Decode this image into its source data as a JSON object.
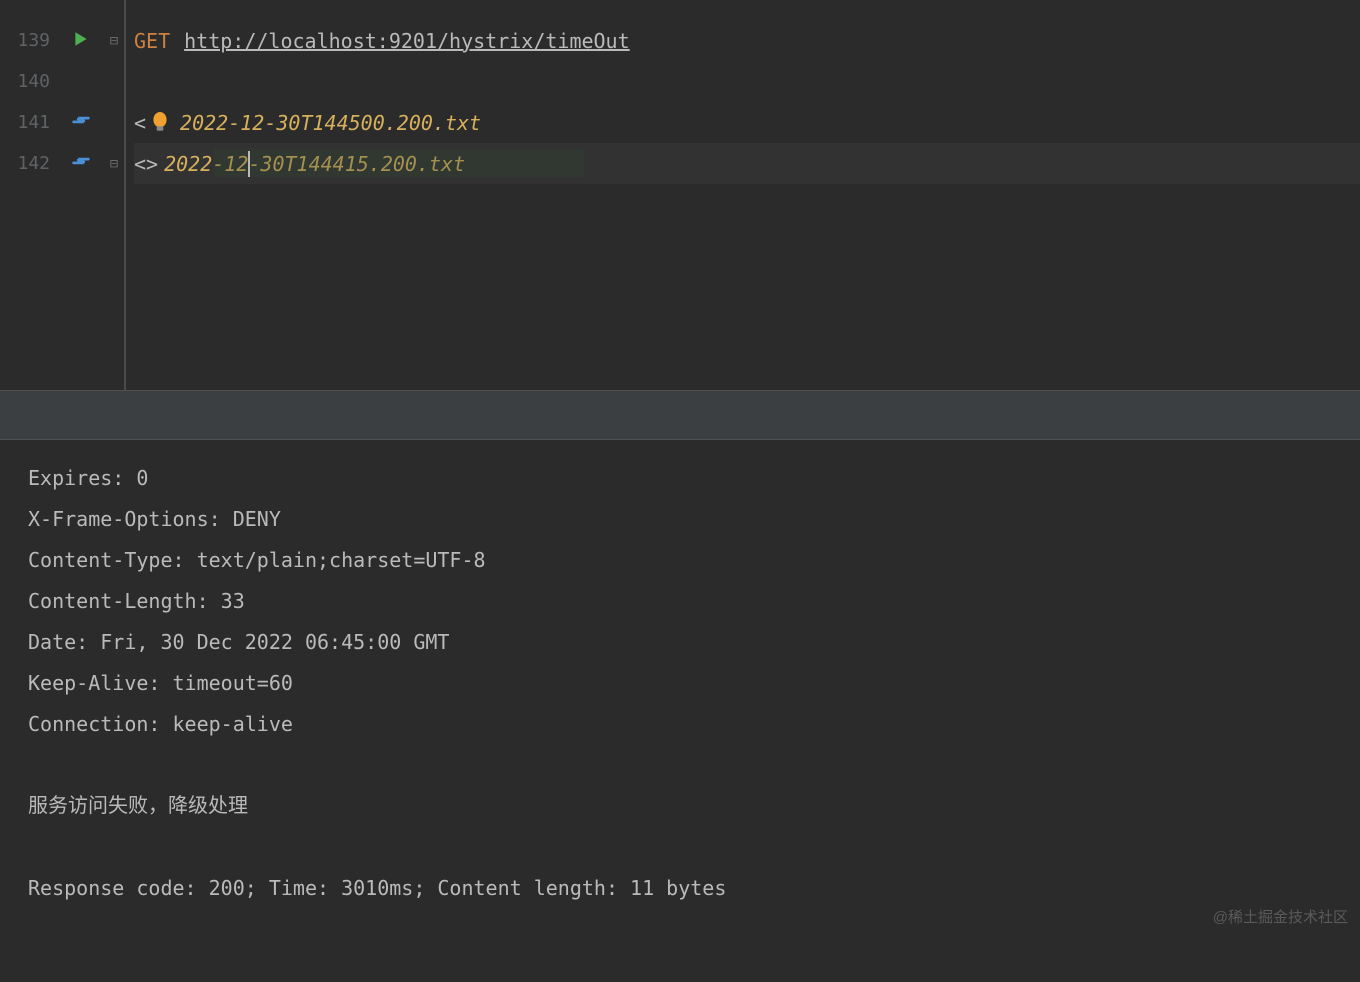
{
  "editor": {
    "lines": {
      "l139": "139",
      "l140": "140",
      "l141": "141",
      "l142": "142"
    },
    "method": "GET",
    "url": "http://localhost:9201/hystrix/timeOut",
    "file1": "2022-12-30T144500.200.txt",
    "file2": "2022-12-30T144415.200.txt"
  },
  "output": {
    "h1": "Expires: 0",
    "h2": "X-Frame-Options: DENY",
    "h3": "Content-Type: text/plain;charset=UTF-8",
    "h4": "Content-Length: 33",
    "h5": "Date: Fri, 30 Dec 2022 06:45:00 GMT",
    "h6": "Keep-Alive: timeout=60",
    "h7": "Connection: keep-alive",
    "body": "服务访问失败，降级处理",
    "status": "Response code: 200; Time: 3010ms; Content length: 11 bytes"
  },
  "watermark": "@稀土掘金技术社区"
}
